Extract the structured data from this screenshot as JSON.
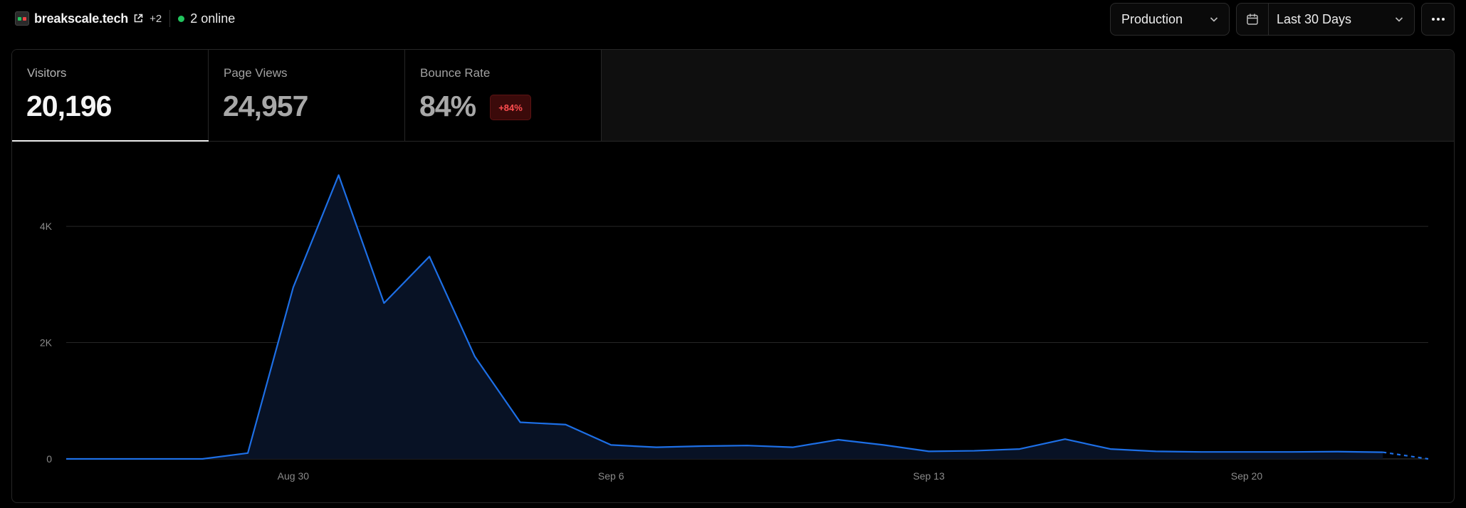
{
  "header": {
    "site_name": "breakscale.tech",
    "extra_count": "+2",
    "online_text": "2 online",
    "environment": "Production",
    "date_range": "Last 30 Days"
  },
  "colors": {
    "line": "#1d6fe6",
    "area": "#081225",
    "online_dot": "#22c55e",
    "badge_text": "#ff4d4f"
  },
  "metrics": [
    {
      "label": "Visitors",
      "value": "20,196"
    },
    {
      "label": "Page Views",
      "value": "24,957"
    },
    {
      "label": "Bounce Rate",
      "value": "84%",
      "badge": "+84%"
    }
  ],
  "chart_data": {
    "type": "area",
    "x": [
      "Aug 25",
      "Aug 26",
      "Aug 27",
      "Aug 28",
      "Aug 29",
      "Aug 30",
      "Aug 31",
      "Sep 1",
      "Sep 2",
      "Sep 3",
      "Sep 4",
      "Sep 5",
      "Sep 6",
      "Sep 7",
      "Sep 8",
      "Sep 9",
      "Sep 10",
      "Sep 11",
      "Sep 12",
      "Sep 13",
      "Sep 14",
      "Sep 15",
      "Sep 16",
      "Sep 17",
      "Sep 18",
      "Sep 19",
      "Sep 20",
      "Sep 21",
      "Sep 22",
      "Sep 23",
      "Sep 24"
    ],
    "series": [
      {
        "values": [
          0,
          0,
          0,
          0,
          100,
          2950,
          4880,
          2680,
          3480,
          1760,
          630,
          590,
          240,
          200,
          220,
          230,
          200,
          330,
          240,
          130,
          140,
          170,
          340,
          170,
          130,
          120,
          120,
          120,
          125,
          115,
          0
        ]
      }
    ],
    "x_tick_labels": [
      "Aug 30",
      "Sep 6",
      "Sep 13",
      "Sep 20"
    ],
    "y_tick_labels": [
      "0",
      "2K",
      "4K"
    ],
    "ylim": [
      0,
      5200
    ],
    "grid": true,
    "dashed_last_segment": true
  }
}
